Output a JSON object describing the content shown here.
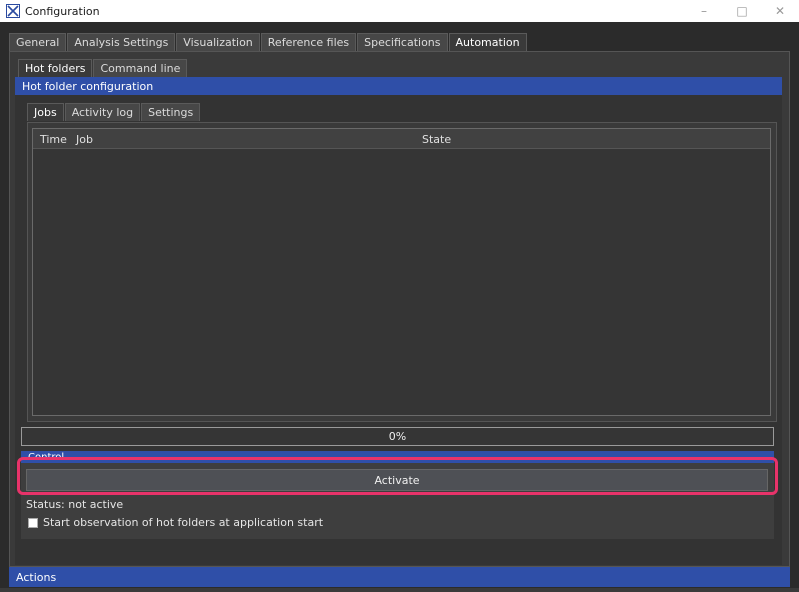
{
  "window": {
    "title": "Configuration",
    "icon": "app-logo-icon",
    "controls": [
      "minimize-icon",
      "maximize-icon",
      "close-icon"
    ]
  },
  "top_tabs": [
    {
      "label": "General",
      "active": false
    },
    {
      "label": "Analysis Settings",
      "active": false
    },
    {
      "label": "Visualization",
      "active": false
    },
    {
      "label": "Reference files",
      "active": false
    },
    {
      "label": "Specifications",
      "active": false
    },
    {
      "label": "Automation",
      "active": true
    }
  ],
  "sub_tabs": [
    {
      "label": "Hot folders",
      "active": true
    },
    {
      "label": "Command line",
      "active": false
    }
  ],
  "hot_folder_section": {
    "title": "Hot folder configuration"
  },
  "inner_tabs": [
    {
      "label": "Jobs",
      "active": true
    },
    {
      "label": "Activity log",
      "active": false
    },
    {
      "label": "Settings",
      "active": false
    }
  ],
  "jobs_table": {
    "columns": [
      "Time",
      "Job",
      "State"
    ],
    "rows": []
  },
  "progress": {
    "value": 0,
    "text": "0%"
  },
  "control": {
    "title": "Control",
    "activate_label": "Activate",
    "status": "Status: not active",
    "start_observation_label": "Start observation of hot folders at application start",
    "start_observation_checked": false
  },
  "actions": {
    "title": "Actions"
  },
  "colors": {
    "accent": "#2f4fa8",
    "highlight": "#e8336a",
    "background": "#2b2b2b"
  }
}
